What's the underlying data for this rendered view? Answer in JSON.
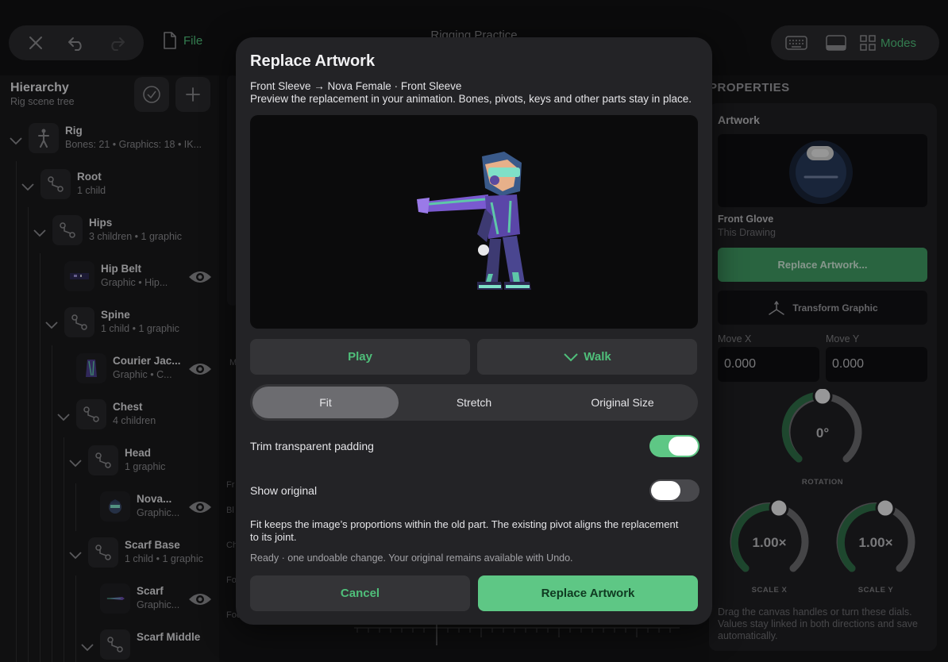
{
  "app": {
    "title": "Rigging Practice",
    "file_label": "File",
    "modes_label": "Modes"
  },
  "hierarchy": {
    "title": "Hierarchy",
    "subtitle": "Rig scene tree",
    "rows": [
      {
        "name": "Rig",
        "meta": "Bones: 21  •  Graphics: 18  •  IK...",
        "icon": "rig-figure-icon",
        "expanded": true
      },
      {
        "name": "Root",
        "meta": "1 child",
        "icon": "bone-icon",
        "expanded": true
      },
      {
        "name": "Hips",
        "meta": "3 children  •  1 graphic",
        "icon": "bone-icon",
        "expanded": true
      },
      {
        "name": "Hip Belt",
        "meta": "Graphic  •  Hip...",
        "icon": "graphic-thumb",
        "visible": true
      },
      {
        "name": "Spine",
        "meta": "1 child  •  1 graphic",
        "icon": "bone-icon",
        "expanded": true
      },
      {
        "name": "Courier Jac...",
        "meta": "Graphic  •  C...",
        "icon": "graphic-thumb",
        "visible": true
      },
      {
        "name": "Chest",
        "meta": "4 children",
        "icon": "bone-icon",
        "expanded": true
      },
      {
        "name": "Head",
        "meta": "1 graphic",
        "icon": "bone-icon",
        "expanded": true
      },
      {
        "name": "Nova...",
        "meta": "Graphic...",
        "icon": "graphic-thumb",
        "visible": true
      },
      {
        "name": "Scarf Base",
        "meta": "1 child  •  1 graphic",
        "icon": "bone-icon",
        "expanded": true
      },
      {
        "name": "Scarf",
        "meta": "Graphic...",
        "icon": "graphic-thumb",
        "visible": true
      },
      {
        "name": "Scarf Middle",
        "meta": "",
        "icon": "bone-icon",
        "expanded": true
      }
    ]
  },
  "middle": {
    "labels": [
      "M",
      "Fr",
      "Bl",
      "Ch",
      "Fo",
      "Foo"
    ]
  },
  "properties": {
    "title": "PROPERTIES",
    "section": "Artwork",
    "graphic_name": "Front Glove",
    "graphic_source": "This Drawing",
    "replace_button": "Replace Artwork...",
    "transform_button": "Transform Graphic",
    "move_x_label": "Move X",
    "move_x_value": "0.000",
    "move_y_label": "Move Y",
    "move_y_value": "0.000",
    "rotation_value": "0°",
    "rotation_label": "ROTATION",
    "scale_x_value": "1.00×",
    "scale_x_label": "SCALE X",
    "scale_y_value": "1.00×",
    "scale_y_label": "SCALE Y",
    "footer": "Drag the canvas handles or turn these dials. Values stay linked in both directions and save automatically."
  },
  "modal": {
    "title": "Replace Artwork",
    "path": "Front Sleeve → Nova Female · Front Sleeve",
    "description": "Preview the replacement in your animation. Bones, pivots, keys and other parts stay in place.",
    "play_label": "Play",
    "animation_label": "Walk",
    "fit_options": [
      "Fit",
      "Stretch",
      "Original Size"
    ],
    "selected_fit": "Fit",
    "trim_label": "Trim transparent padding",
    "trim_on": true,
    "show_original_label": "Show original",
    "show_original_on": false,
    "help": "Fit keeps the image’s proportions within the old part. The existing pivot aligns the replacement to its joint.",
    "status": "Ready · one undoable change. Your original remains available with Undo.",
    "cancel_label": "Cancel",
    "confirm_label": "Replace Artwork"
  },
  "colors": {
    "accent": "#4fbf7a",
    "accent_button": "#5ec785",
    "toggle_on": "#5ec785",
    "toggle_off": "#48484c"
  }
}
